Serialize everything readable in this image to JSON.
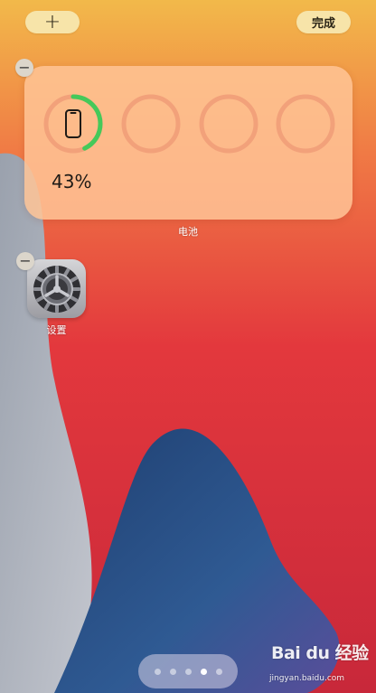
{
  "colors": {
    "wallpaper_top": "#f2b94a",
    "wallpaper_red": "#e23a3c",
    "wallpaper_grey": "#b8bcc6",
    "wallpaper_blue": "#2b4f86",
    "pill_button": "#f7e4a9",
    "ring_active": "#45c95a",
    "ring_track": "#f2a17a"
  },
  "toolbar": {
    "add_label": "+",
    "done_label": "完成"
  },
  "battery_widget": {
    "label": "电池",
    "percent_text": "43%",
    "level": 0.43,
    "device_icon": "iphone-icon",
    "remove_icon": "minus-icon"
  },
  "apps": [
    {
      "label": "设置",
      "icon": "gear-icon",
      "remove_icon": "minus-icon"
    }
  ],
  "page_indicator": {
    "count": 5,
    "current": 4
  },
  "watermark": {
    "logo": "Bai du 经验",
    "url": "jingyan.baidu.com"
  }
}
